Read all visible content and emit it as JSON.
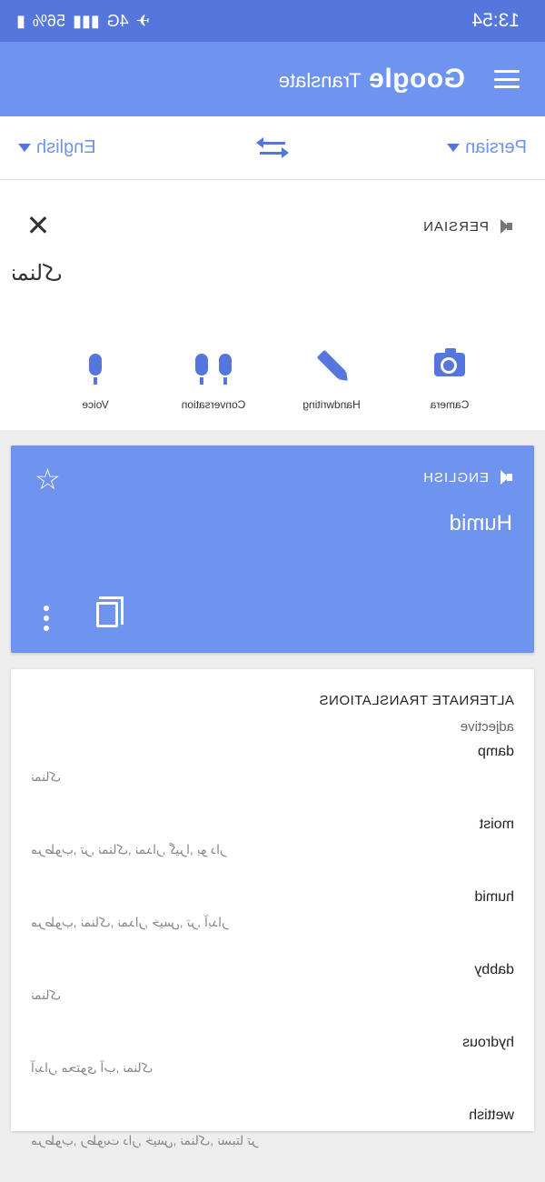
{
  "status_bar": {
    "time": "13:54",
    "battery": "56%",
    "network": "4G"
  },
  "app_bar": {
    "brand": "Google",
    "title": "Translate"
  },
  "languages": {
    "source": "Persian",
    "target": "English"
  },
  "input": {
    "language_label": "PERSIAN",
    "text": "نمناک"
  },
  "tools": [
    {
      "label": "Camera",
      "icon": "camera-icon"
    },
    {
      "label": "Handwriting",
      "icon": "pen-icon"
    },
    {
      "label": "Conversation",
      "icon": "mic-icon"
    },
    {
      "label": "Voice",
      "icon": "mic-icon"
    }
  ],
  "result": {
    "language_label": "ENGLISH",
    "text": "Humid"
  },
  "alternates": {
    "title": "ALTERNATE TRANSLATIONS",
    "part_of_speech": "adjective",
    "entries": [
      {
        "word": "damp",
        "synonyms": "نمناک"
      },
      {
        "word": "moist",
        "synonyms": "مرطوب, تر, نمناک, نمدار, گیرا, بو دار"
      },
      {
        "word": "humid",
        "synonyms": "مرطوب, نمناک, نمدار, خیس, تر, آبدار"
      },
      {
        "word": "dabby",
        "synonyms": "نمناک"
      },
      {
        "word": "hydrous",
        "synonyms": "آبدار, محتوی آب, نمناک"
      },
      {
        "word": "wettish",
        "synonyms": "مرطوب, رطوبت دار, خیس, نمناک, نسبتا تر"
      }
    ]
  },
  "colors": {
    "accent": "#6f94ef",
    "status": "#5577dd"
  }
}
